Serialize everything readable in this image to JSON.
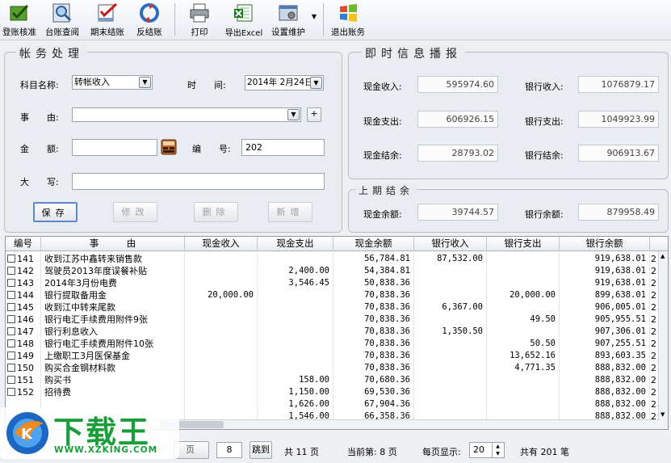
{
  "toolbar": {
    "items": [
      {
        "label": "登账核准",
        "icon": "approve-book-icon"
      },
      {
        "label": "台账查阅",
        "icon": "magnifier-icon"
      },
      {
        "label": "期末结账",
        "icon": "checklist-icon"
      },
      {
        "label": "反结账",
        "icon": "undo-arrows-icon"
      },
      {
        "label": "打印",
        "icon": "printer-icon"
      },
      {
        "label": "导出Excel",
        "icon": "excel-icon"
      },
      {
        "label": "设置维护",
        "icon": "settings-icon"
      },
      {
        "label": "退出账务",
        "icon": "windows-exit-icon"
      }
    ]
  },
  "entry": {
    "title": "帐务处理",
    "subject_label": "科目名称:",
    "subject_value": "转帐收入",
    "time_label": "时　　间:",
    "time_value": "2014年 2月24日",
    "event_label": "事　　由:",
    "event_value": "",
    "amount_label": "金　　额:",
    "amount_value": "",
    "number_label": "编　　号:",
    "number_value": "202",
    "capital_label": "大　　写:",
    "capital_value": "",
    "add_symbol": "+",
    "buttons": {
      "save": "保存",
      "modify": "修改",
      "delete": "删除",
      "new": "新增"
    }
  },
  "broadcast": {
    "title": "即时信息播报",
    "cash_income_label": "现金收入:",
    "cash_income": "595974.60",
    "bank_income_label": "银行收入:",
    "bank_income": "1076879.17",
    "cash_expense_label": "现金支出:",
    "cash_expense": "606926.15",
    "bank_expense_label": "银行支出:",
    "bank_expense": "1049923.99",
    "cash_balance_label": "现金结余:",
    "cash_balance": "28793.02",
    "bank_balance_label": "银行结余:",
    "bank_balance": "906913.67"
  },
  "last_period": {
    "title": "上期结余",
    "cash_label": "现金余额:",
    "cash": "39744.57",
    "bank_label": "银行余额:",
    "bank": "879958.49"
  },
  "table": {
    "columns": [
      "编号",
      "事　　　由",
      "现金收入",
      "现金支出",
      "现金余额",
      "银行收入",
      "银行支出",
      "银行余额"
    ],
    "rows": [
      {
        "id": "141",
        "event": "收到江苏中鑫转来销售款",
        "cash_in": "",
        "cash_out": "",
        "cash_bal": "56,784.81",
        "bank_in": "87,532.00",
        "bank_out": "",
        "bank_bal": "919,638.01",
        "extra": "2"
      },
      {
        "id": "142",
        "event": "驾驶员2013年度误餐补贴",
        "cash_in": "",
        "cash_out": "2,400.00",
        "cash_bal": "54,384.81",
        "bank_in": "",
        "bank_out": "",
        "bank_bal": "919,638.01",
        "extra": "2"
      },
      {
        "id": "143",
        "event": "2014年3月份电费",
        "cash_in": "",
        "cash_out": "3,546.45",
        "cash_bal": "50,838.36",
        "bank_in": "",
        "bank_out": "",
        "bank_bal": "919,638.01",
        "extra": "2"
      },
      {
        "id": "144",
        "event": "银行提取备用金",
        "cash_in": "20,000.00",
        "cash_out": "",
        "cash_bal": "70,838.36",
        "bank_in": "",
        "bank_out": "20,000.00",
        "bank_bal": "899,638.01",
        "extra": "2"
      },
      {
        "id": "145",
        "event": "收到江中转来尾款",
        "cash_in": "",
        "cash_out": "",
        "cash_bal": "70,838.36",
        "bank_in": "6,367.00",
        "bank_out": "",
        "bank_bal": "906,005.01",
        "extra": "2"
      },
      {
        "id": "146",
        "event": "银行电汇手续费用附件9张",
        "cash_in": "",
        "cash_out": "",
        "cash_bal": "70,838.36",
        "bank_in": "",
        "bank_out": "49.50",
        "bank_bal": "905,955.51",
        "extra": "2"
      },
      {
        "id": "147",
        "event": "银行利息收入",
        "cash_in": "",
        "cash_out": "",
        "cash_bal": "70,838.36",
        "bank_in": "1,350.50",
        "bank_out": "",
        "bank_bal": "907,306.01",
        "extra": "2"
      },
      {
        "id": "148",
        "event": "银行电汇手续费用附件10张",
        "cash_in": "",
        "cash_out": "",
        "cash_bal": "70,838.36",
        "bank_in": "",
        "bank_out": "50.50",
        "bank_bal": "907,255.51",
        "extra": "2"
      },
      {
        "id": "149",
        "event": "上缴职工3月医保基金",
        "cash_in": "",
        "cash_out": "",
        "cash_bal": "70,838.36",
        "bank_in": "",
        "bank_out": "13,652.16",
        "bank_bal": "893,603.35",
        "extra": "2"
      },
      {
        "id": "150",
        "event": "购买合金钢材料款",
        "cash_in": "",
        "cash_out": "",
        "cash_bal": "70,838.36",
        "bank_in": "",
        "bank_out": "4,771.35",
        "bank_bal": "888,832.00",
        "extra": "2"
      },
      {
        "id": "151",
        "event": "购买书",
        "cash_in": "",
        "cash_out": "158.00",
        "cash_bal": "70,680.36",
        "bank_in": "",
        "bank_out": "",
        "bank_bal": "888,832.00",
        "extra": "2"
      },
      {
        "id": "152",
        "event": "招待费",
        "cash_in": "",
        "cash_out": "1,150.00",
        "cash_bal": "69,530.36",
        "bank_in": "",
        "bank_out": "",
        "bank_bal": "888,832.00",
        "extra": "2"
      },
      {
        "id": "",
        "event": "",
        "cash_in": "",
        "cash_out": "1,626.00",
        "cash_bal": "67,904.36",
        "bank_in": "",
        "bank_out": "",
        "bank_bal": "888,832.00",
        "extra": "2"
      },
      {
        "id": "",
        "event": "",
        "cash_in": "",
        "cash_out": "1,546.00",
        "cash_bal": "66,358.36",
        "bank_in": "",
        "bank_out": "",
        "bank_bal": "888,832.00",
        "extra": "2"
      }
    ]
  },
  "pager": {
    "prev_label": "页",
    "page_input": "8",
    "jump_label": "跳到",
    "total_pages": "共 11 页",
    "current_page": "当前第: 8 页",
    "per_page_label": "每页显示:",
    "per_page": "20",
    "total_records": "共有 201 笔"
  },
  "watermark": {
    "brand": "下载王",
    "url": "WWW.XZKING.COM"
  }
}
